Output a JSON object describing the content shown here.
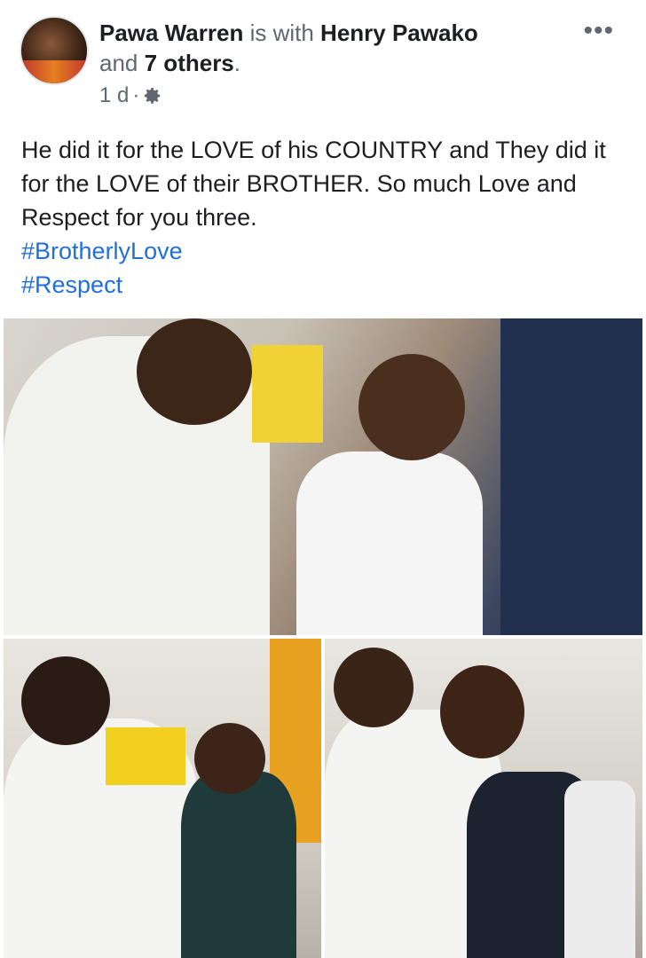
{
  "post": {
    "author": "Pawa Warren",
    "with_text": "is with",
    "tagged": "Henry Pawako",
    "and_text": "and",
    "others": "7 others",
    "period": ".",
    "time": "1 d",
    "dot": "·",
    "privacy_icon": "gear-icon",
    "more_icon": "more-options-icon",
    "more_glyph": "•••"
  },
  "content": {
    "text": "He did it for the LOVE  of his COUNTRY and They did it for the LOVE of  their BROTHER. So much Love and Respect for you three.",
    "hashtags": [
      "#BrotherlyLove",
      "#Respect"
    ]
  },
  "colors": {
    "hashtag": "#216fdb",
    "secondary_text": "#606770",
    "primary_text": "#1c1e21"
  }
}
